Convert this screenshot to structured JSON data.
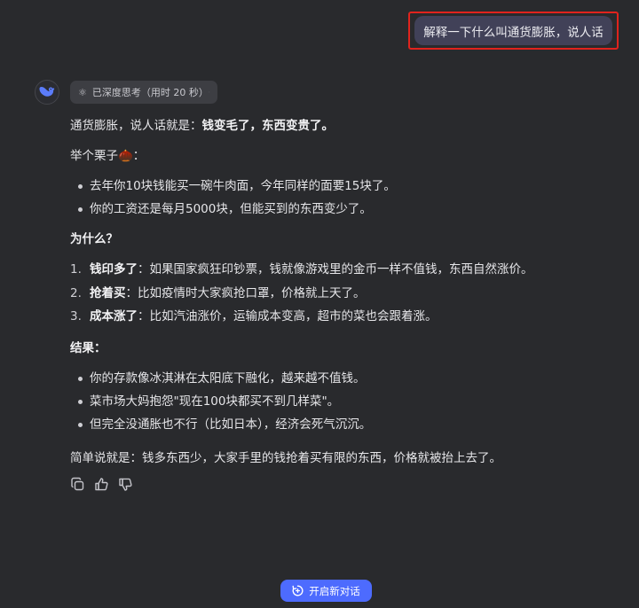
{
  "user_message": "解释一下什么叫通货膨胀，说人话",
  "thinking": {
    "label": "已深度思考（用时 20 秒）"
  },
  "answer": {
    "intro_prefix": "通货膨胀，说人话就是：",
    "intro_bold": "钱变毛了，东西变贵了。",
    "example_label": "举个栗子🌰：",
    "examples": [
      "去年你10块钱能买一碗牛肉面，今年同样的面要15块了。",
      "你的工资还是每月5000块，但能买到的东西变少了。"
    ],
    "why_heading": "为什么？",
    "reasons": [
      {
        "num": "1.",
        "bold": "钱印多了",
        "text": "：如果国家疯狂印钞票，钱就像游戏里的金币一样不值钱，东西自然涨价。"
      },
      {
        "num": "2.",
        "bold": "抢着买",
        "text": "：比如疫情时大家疯抢口罩，价格就上天了。"
      },
      {
        "num": "3.",
        "bold": "成本涨了",
        "text": "：比如汽油涨价，运输成本变高，超市的菜也会跟着涨。"
      }
    ],
    "result_heading": "结果：",
    "results": [
      "你的存款像冰淇淋在太阳底下融化，越来越不值钱。",
      "菜市场大妈抱怨\"现在100块都买不到几样菜\"。",
      "但完全没通胀也不行（比如日本），经济会死气沉沉。"
    ],
    "summary": "简单说就是：钱多东西少，大家手里的钱抢着买有限的东西，价格就被抬上去了。"
  },
  "actions": {
    "icons": [
      "copy-icon",
      "thumbs-up-icon",
      "thumbs-down-icon"
    ]
  },
  "new_chat": {
    "label": "开启新对话"
  },
  "colors": {
    "background": "#292a2d",
    "user_bubble": "#414158",
    "highlight_border": "#e0231d",
    "accent": "#4d6bfe"
  }
}
